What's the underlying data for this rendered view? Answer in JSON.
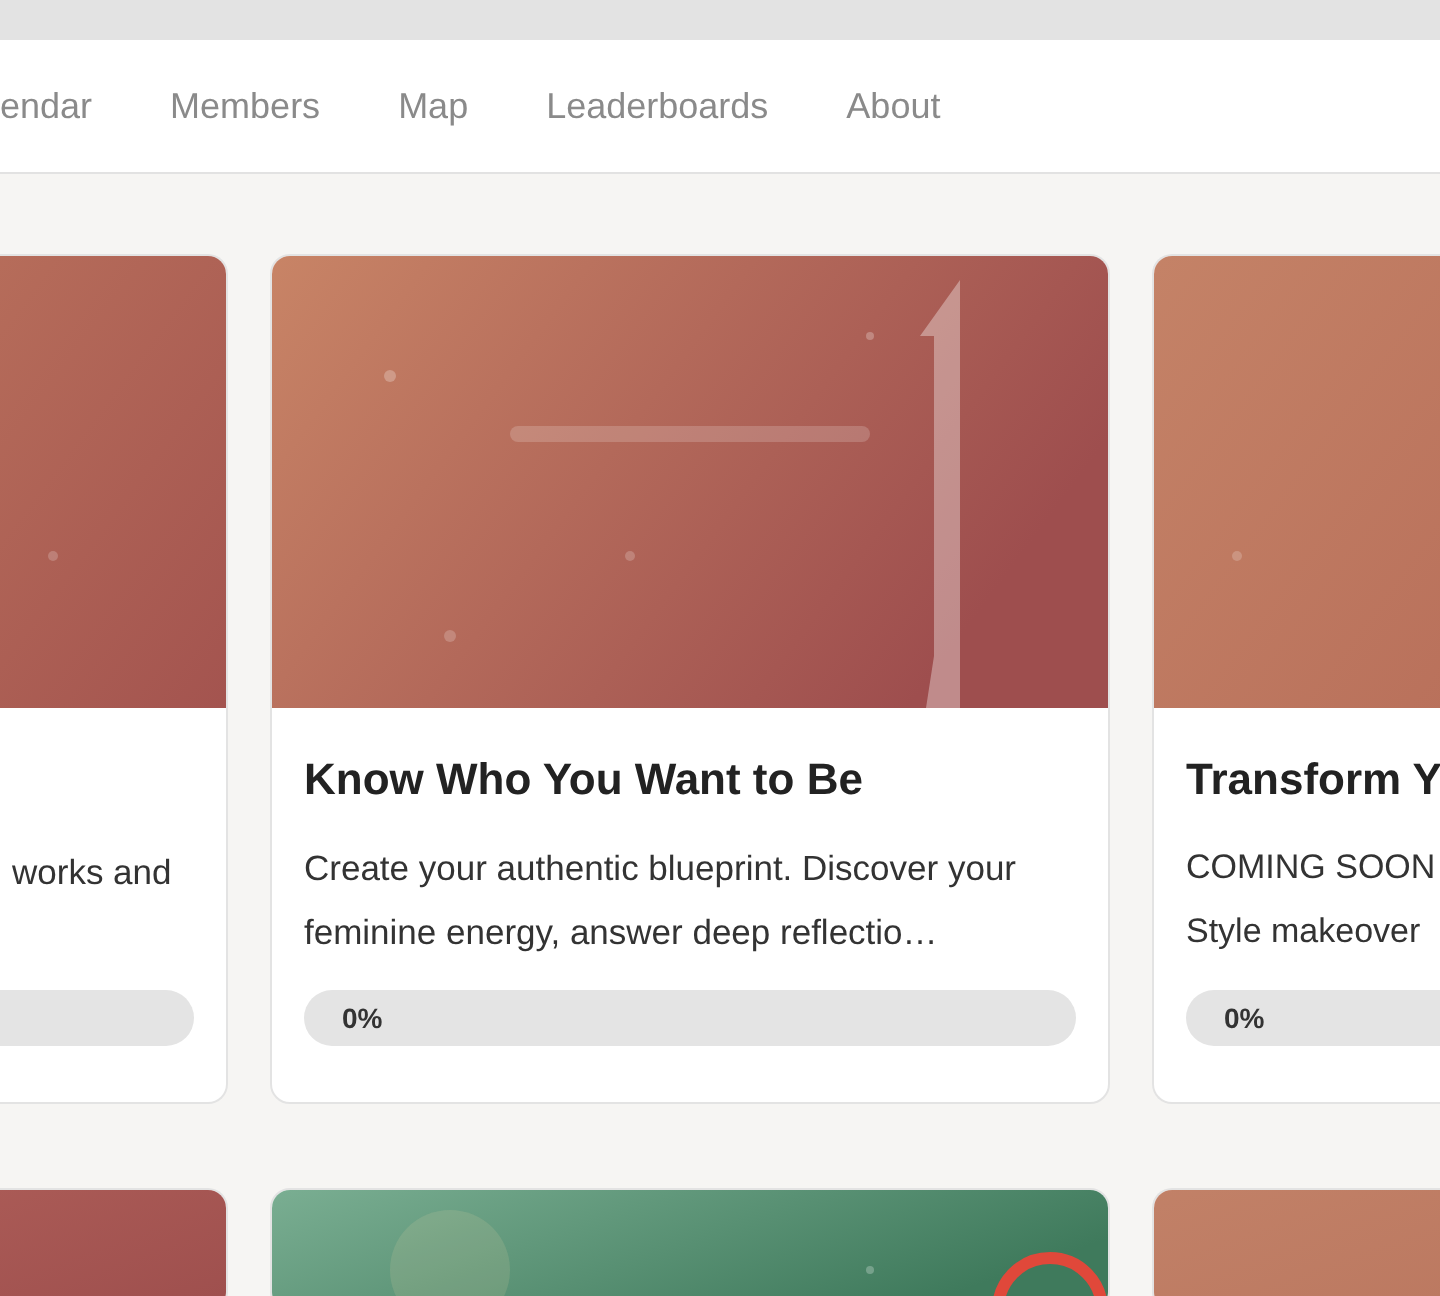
{
  "nav": {
    "items": [
      "endar",
      "Members",
      "Map",
      "Leaderboards",
      "About"
    ]
  },
  "courses": [
    {
      "description": "works and",
      "progress": {
        "level": 0
      }
    },
    {
      "title": "Know Who You Want to Be",
      "description": "Create your authentic blueprint. Discover your feminine energy, answer deep reflectio…",
      "progress": {
        "label": "0%",
        "level": 0
      }
    },
    {
      "title": "Transform Y",
      "description": "COMING SOON Style makeover",
      "progress": {
        "label": "0%",
        "level": 0
      }
    }
  ]
}
